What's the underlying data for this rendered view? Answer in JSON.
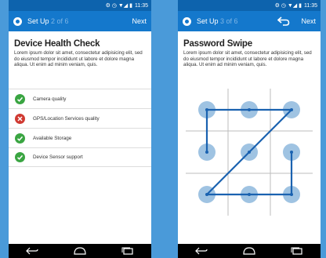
{
  "colors": {
    "background": "#4a9ad9",
    "status_bar": "#0d63ad",
    "app_bar": "#1478cc",
    "success": "#3aa542",
    "error": "#d03a32",
    "pattern_dot": "#9fc3e2",
    "pattern_line": "#1a62b0"
  },
  "status_bar": {
    "time": "11:35"
  },
  "screen_left": {
    "step_label": "Set Up",
    "step_progress": "2 of 6",
    "next_label": "Next",
    "title": "Device Health Check",
    "description": "Lorem ipsum dolor sit amet, consectetur adipisicing elit, sed do eiusmod tempor incididunt ut labore et dolore magna aliqua. Ut enim ad minim veniam, quis.",
    "checks": [
      {
        "label": "Camera quality",
        "status": "pass",
        "icon": "check-icon"
      },
      {
        "label": "GPS/Location Services quality",
        "status": "fail",
        "icon": "x-icon"
      },
      {
        "label": "Available Storage",
        "status": "pass",
        "icon": "check-icon"
      },
      {
        "label": "Device Sensor support",
        "status": "pass",
        "icon": "check-icon"
      }
    ]
  },
  "screen_right": {
    "step_label": "Set Up",
    "step_progress": "3 of 6",
    "next_label": "Next",
    "title": "Password Swipe",
    "description": "Lorem ipsum dolor sit amet, consectetur adipisicing elit, sed do eiusmod tempor incididunt ut labore et dolore magna aliqua. Ut enim ad minim veniam, quis.",
    "pattern_path": [
      4,
      1,
      2,
      3,
      7,
      8,
      9,
      6
    ]
  },
  "nav_icons": [
    "back-icon",
    "home-icon",
    "recents-icon"
  ]
}
